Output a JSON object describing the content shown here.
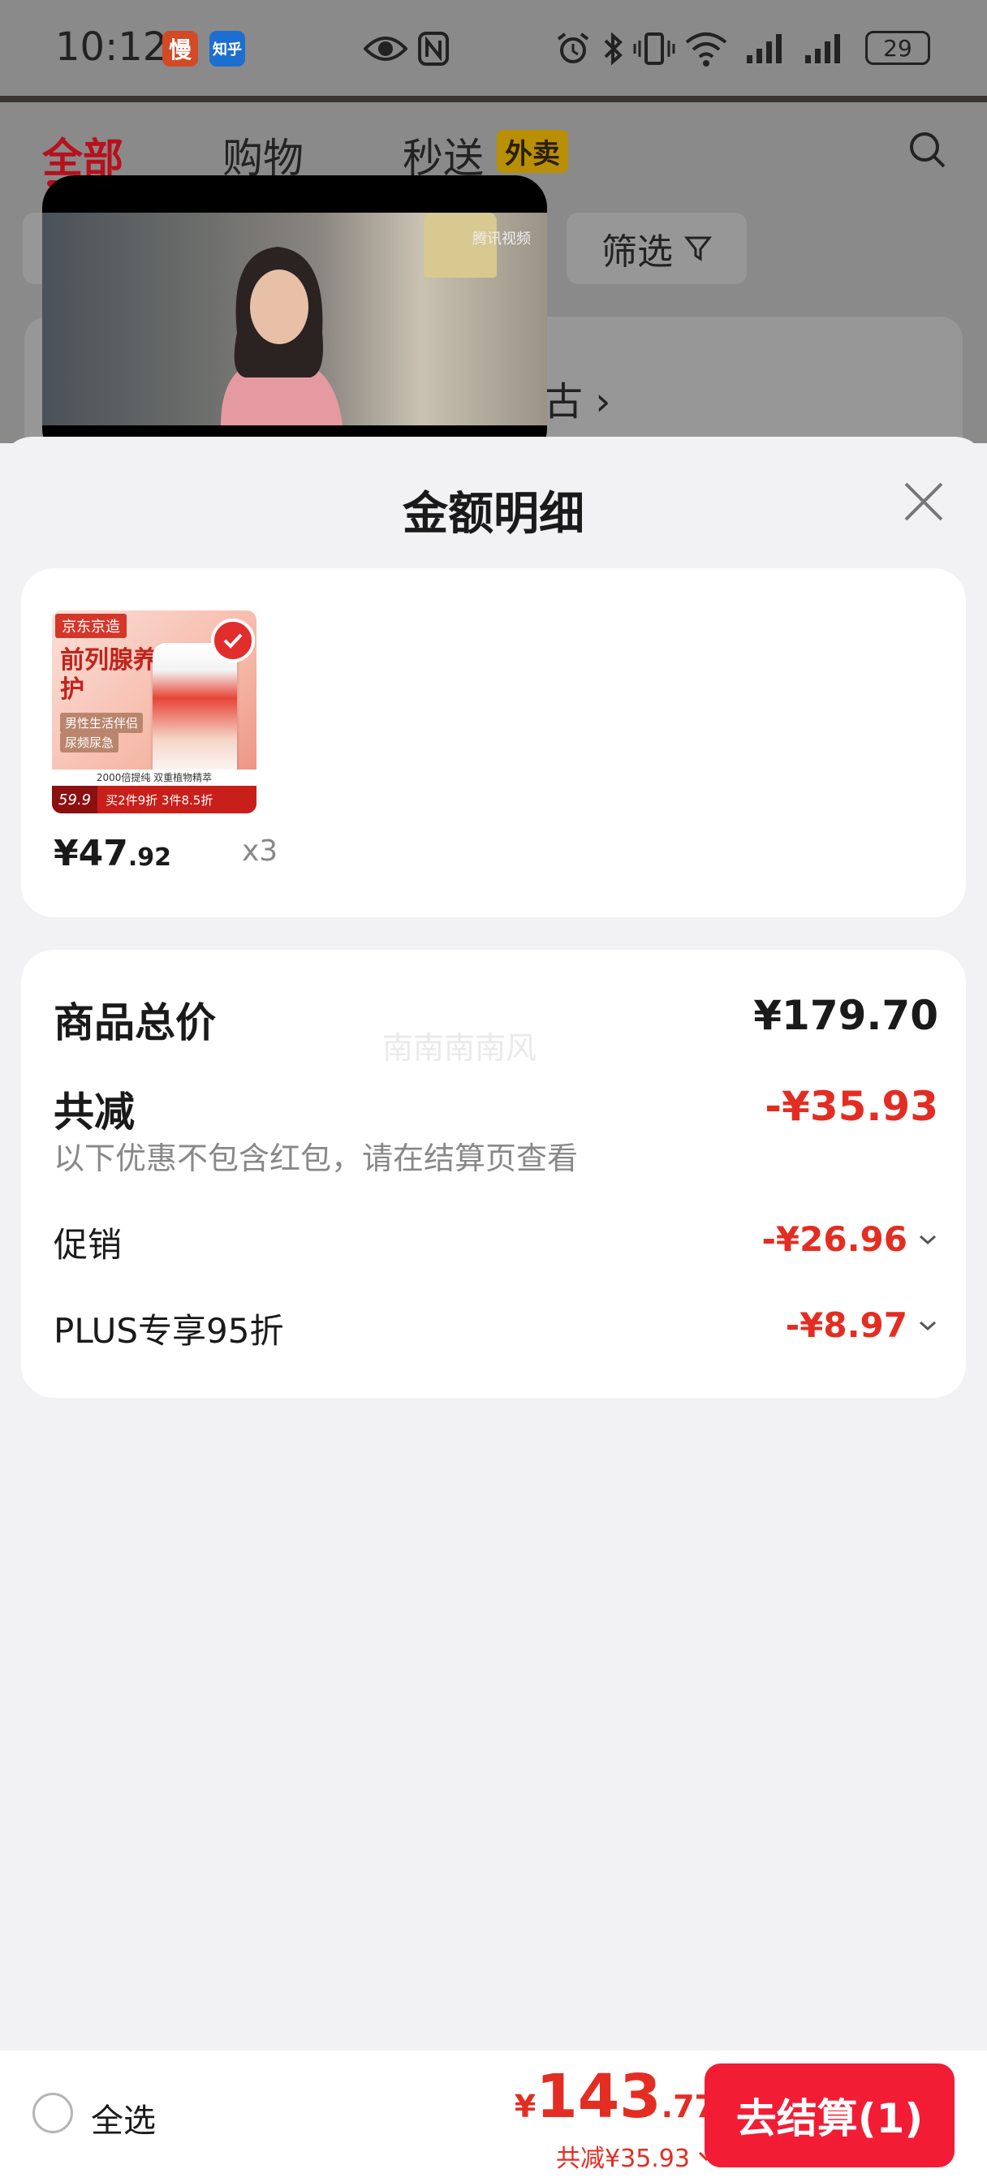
{
  "status_bar": {
    "time": "10:12",
    "app_badges": [
      "慢",
      "知乎"
    ],
    "battery": "29",
    "icons": [
      "eye-icon",
      "nfc-icon",
      "alarm-icon",
      "bluetooth-icon",
      "vibrate-icon",
      "wifi-icon",
      "signal-icon",
      "signal-icon"
    ]
  },
  "background": {
    "tabs": [
      "全部",
      "购物",
      "秒送"
    ],
    "waimai_badge": "外卖",
    "filter_label": "筛选",
    "card_text": "古",
    "accent_color": "#e42d22"
  },
  "video": {
    "watermark": "腾讯视频"
  },
  "sheet": {
    "title": "金额明细",
    "product": {
      "image_top_label": "京东京造",
      "image_title": "前列腺养护",
      "image_tags": [
        "男性生活伴侣",
        "尿频尿急"
      ],
      "image_strip": "2000倍提纯 双重植物精萃",
      "image_price": "59.9",
      "image_promo": "买2件9折 3件8.5折",
      "price_yuan": "¥47",
      "price_cents": ".92",
      "quantity": "x3"
    },
    "summary": {
      "watermark": "南南南南风",
      "total_label": "商品总价",
      "total_value": "¥179.70",
      "reduce_label": "共减",
      "reduce_value": "-¥35.93",
      "note": "以下优惠不包含红包，请在结算页查看",
      "promo_label": "促销",
      "promo_value": "-¥26.96",
      "plus_label": "PLUS专享95折",
      "plus_value": "-¥8.97"
    }
  },
  "bottom_bar": {
    "select_all": "全选",
    "yen": "¥",
    "total_int": "143",
    "total_cents": ".77",
    "discount": "共减¥35.93",
    "checkout": "去结算(1)"
  }
}
